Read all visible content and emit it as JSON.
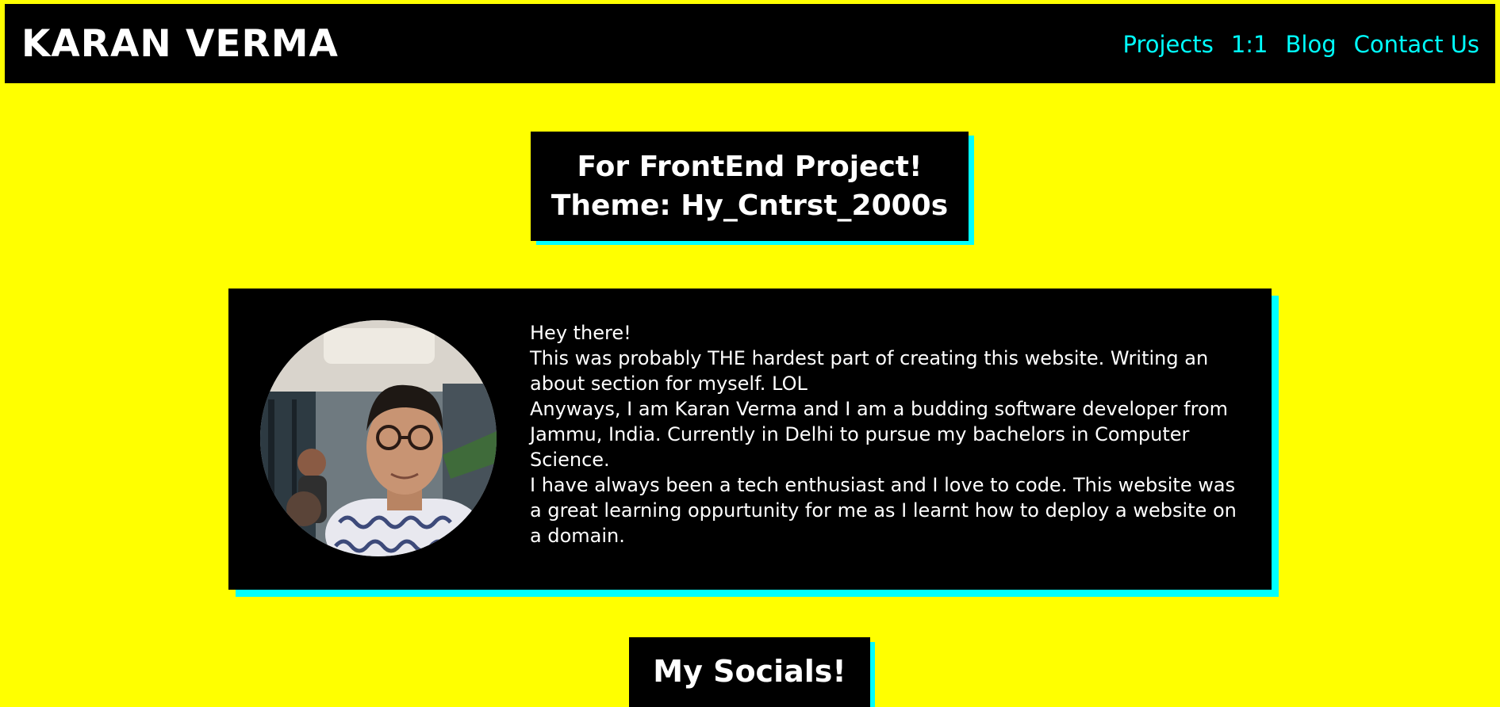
{
  "header": {
    "brand": "KARAN VERMA",
    "nav": [
      {
        "label": "Projects"
      },
      {
        "label": "1:1"
      },
      {
        "label": "Blog"
      },
      {
        "label": "Contact Us"
      }
    ]
  },
  "banner": {
    "line1": "For FrontEnd Project!",
    "line2": "Theme: Hy_Cntrst_2000s"
  },
  "about": {
    "lines": [
      "Hey there!",
      "This was probably THE hardest part of creating this website. Writing an about section for myself. LOL",
      "Anyways, I am Karan Verma and I am a budding software developer from Jammu, India. Currently in Delhi to pursue my bachelors in Computer Science.",
      "I have always been a tech enthusiast and I love to code. This website was a great learning oppurtunity for me as I learnt how to deploy a website on a domain."
    ]
  },
  "socials": {
    "title": "My Socials!"
  },
  "colors": {
    "background": "#ffff00",
    "panel": "#000000",
    "accent": "#00ffff",
    "text": "#ffffff"
  }
}
